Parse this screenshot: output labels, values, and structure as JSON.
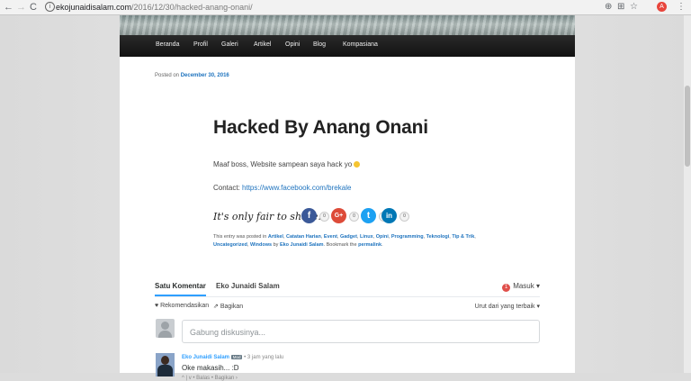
{
  "browser": {
    "url_domain": "ekojunaidisalam.com",
    "url_path": "/2016/12/30/hacked-anang-onani/",
    "back": "←",
    "forward": "→",
    "reload": "C",
    "info": "i",
    "zoom": "⊕",
    "translate": "⊞",
    "star": "☆",
    "menu": "⋮",
    "ext": "A"
  },
  "menu": [
    "Beranda",
    "Profil",
    "Galeri",
    "Artikel",
    "Opini",
    "Blog",
    "Kompasiana"
  ],
  "post": {
    "posted_prefix": "Posted on",
    "date": "December 30, 2016",
    "title": "Hacked By Anang Onani",
    "para1": "Maaf boss, Website sampean saya hack yo",
    "contact_label": "Contact:",
    "contact_link": "https://www.facebook.com/brekale",
    "share_label": "It's only fair to share...",
    "share": {
      "facebook": "f",
      "facebook_count": "0",
      "google": "G+",
      "google_count": "0",
      "twitter": "t",
      "twitter_count": "0",
      "linkedin": "in",
      "linkedin_count": "0"
    },
    "entry": {
      "prefix": "This entry was posted in",
      "categories": [
        "Artikel",
        "Catatan Harian",
        "Event",
        "Gadget",
        "Linux",
        "Opini",
        "Programming",
        "Teknologi",
        "Tip & Trik",
        "Uncategorized",
        "Windows"
      ],
      "by": "by",
      "author": "Eko Junaidi Salam",
      "bookmark": ". Bookmark the",
      "permalink": "permalink",
      "end": "."
    }
  },
  "disqus": {
    "tab_comments": "Satu Komentar",
    "tab_site": "Eko Junaidi Salam",
    "login_badge": "1",
    "login": "Masuk",
    "recommend": "Rekomendasikan",
    "share": "Bagikan",
    "sort": "Urut dari yang terbaik",
    "input_placeholder": "Gabung diskusinya...",
    "comment": {
      "author": "Eko Junaidi Salam",
      "mod": "Mod",
      "time": "• 3 jam yang lalu",
      "text": "Oke makasih... :D",
      "actions": "^ | v • Balas • Bagikan ›"
    }
  }
}
